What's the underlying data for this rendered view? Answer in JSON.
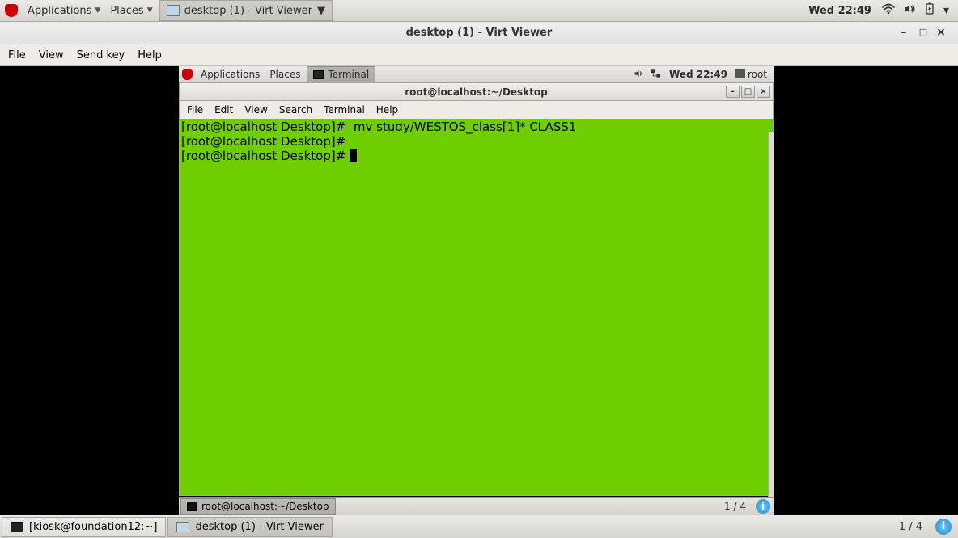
{
  "host": {
    "panel": {
      "applications": "Applications",
      "places": "Places",
      "task_label": "desktop (1) - Virt Viewer",
      "clock": "Wed 22:49"
    },
    "bottom": {
      "task1": "[kiosk@foundation12:~]",
      "task2": "desktop (1) - Virt Viewer",
      "pager": "1 / 4"
    }
  },
  "vv": {
    "title": "desktop (1) - Virt Viewer",
    "menu": {
      "file": "File",
      "view": "View",
      "sendkey": "Send key",
      "help": "Help"
    }
  },
  "guest": {
    "panel": {
      "applications": "Applications",
      "places": "Places",
      "task_label": "Terminal",
      "clock": "Wed 22:49",
      "user": "root"
    },
    "bottom": {
      "task": "root@localhost:~/Desktop",
      "pager": "1 / 4"
    }
  },
  "term": {
    "title": "root@localhost:~/Desktop",
    "menu": {
      "file": "File",
      "edit": "Edit",
      "view": "View",
      "search": "Search",
      "terminal": "Terminal",
      "help": "Help"
    },
    "lines": {
      "l1": "[root@localhost Desktop]#  mv study/WESTOS_class[1]* CLASS1",
      "l2": "[root@localhost Desktop]# ",
      "l3": "[root@localhost Desktop]# "
    }
  }
}
